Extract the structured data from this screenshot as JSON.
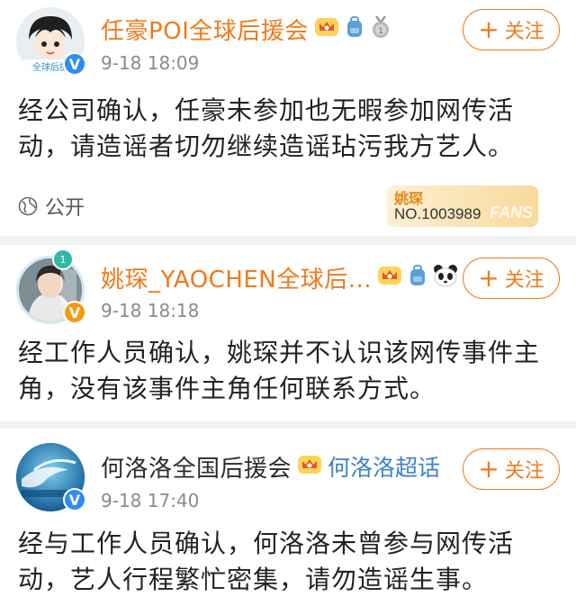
{
  "posts": [
    {
      "name": "任豪POI全球后援会",
      "time": "9-18 18:09",
      "follow_label": "关注",
      "content": "经公司确认，任豪未参加也无暇参加网传活动，请造谣者切勿继续造谣玷污我方艺人。",
      "visibility": "公开",
      "fans_card": {
        "name": "姚琛",
        "number": "NO.1003989",
        "word": "FANS"
      },
      "avatar_text": "全球后援"
    },
    {
      "name": "姚琛_YAOCHEN全球后...",
      "time": "9-18 18:18",
      "follow_label": "关注",
      "content": "经工作人员确认，姚琛并不认识该网传事件主角，没有该事件主角任何联系方式。"
    },
    {
      "name": "何洛洛全国后援会",
      "supertopic": "何洛洛超话",
      "time": "9-18 17:40",
      "follow_label": "关注",
      "content": "经与工作人员确认，何洛洛未曾参与网传活动，艺人行程繁忙密集，请勿造谣生事。"
    }
  ],
  "colors": {
    "accent": "#f07a1b",
    "link": "#3e82c5",
    "meta": "#8a8a8a"
  }
}
